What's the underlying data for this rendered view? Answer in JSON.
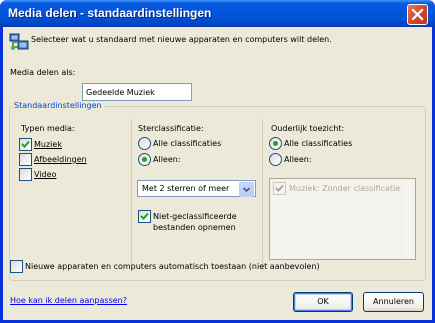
{
  "window": {
    "title": "Media delen - standaardinstellingen"
  },
  "header": {
    "description": "Selecteer wat u standaard met nieuwe apparaten en computers wilt delen."
  },
  "share_as": {
    "label": "Media delen als:",
    "value": "Gedeelde Muziek"
  },
  "defaults_group": {
    "legend": "Standaardinstellingen",
    "media_types": {
      "heading": "Typen media:",
      "items": [
        {
          "label": "Muziek",
          "checked": true
        },
        {
          "label": "Afbeeldingen",
          "checked": false
        },
        {
          "label": "Video",
          "checked": false
        }
      ]
    },
    "star_rating": {
      "heading": "Sterclassificatie:",
      "options": [
        {
          "label": "Alle classificaties",
          "selected": false
        },
        {
          "label": "Alleen:",
          "selected": true
        }
      ],
      "dropdown_value": "Met 2 sterren of meer",
      "include_unrated_line1": "Niet-geclassificeerde",
      "include_unrated_line2": "bestanden opnemen",
      "include_unrated_checked": true
    },
    "parental": {
      "heading": "Ouderlijk toezicht:",
      "options": [
        {
          "label": "Alle classificaties",
          "selected": true
        },
        {
          "label": "Alleen:",
          "selected": false
        }
      ],
      "list_items": [
        {
          "label": "Muziek: Zonder classificatie",
          "checked": true
        }
      ]
    }
  },
  "auto_allow": {
    "label": "Nieuwe apparaten en computers automatisch toestaan (niet aanbevolen)",
    "checked": false
  },
  "footer": {
    "help_link": "Hoe kan ik delen aanpassen?",
    "ok_label": "OK",
    "cancel_label": "Annuleren"
  },
  "colors": {
    "titlebar": "#0052D6",
    "dialog_bg": "#ECE9D8",
    "group_legend": "#0046D5",
    "check_mark": "#21A121",
    "link": "#0000FF"
  }
}
